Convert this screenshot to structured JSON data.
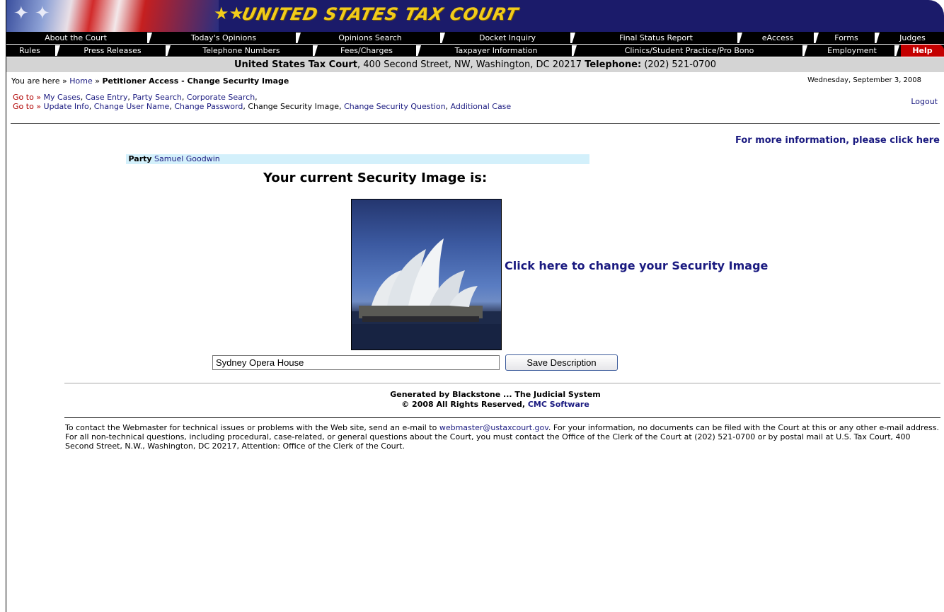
{
  "banner": {
    "title": "UNITED STATES TAX COURT",
    "stars": "★★",
    "flag_stars": [
      "✦",
      "✦"
    ]
  },
  "nav_row1": [
    {
      "label": "About the Court"
    },
    {
      "label": "Today's Opinions"
    },
    {
      "label": "Opinions Search"
    },
    {
      "label": "Docket Inquiry"
    },
    {
      "label": "Final Status Report"
    },
    {
      "label": "eAccess"
    },
    {
      "label": "Forms"
    },
    {
      "label": "Judges"
    }
  ],
  "nav_row2": [
    {
      "label": "Rules"
    },
    {
      "label": "Press Releases"
    },
    {
      "label": "Telephone Numbers"
    },
    {
      "label": "Fees/Charges"
    },
    {
      "label": "Taxpayer Information"
    },
    {
      "label": "Clinics/Student Practice/Pro Bono"
    },
    {
      "label": "Employment"
    },
    {
      "label": "Help"
    }
  ],
  "address": {
    "court": "United States Tax Court",
    "street": ", 400 Second Street, NW, Washington, DC 20217 ",
    "phone_label": "Telephone:",
    "phone": " (202) 521-0700"
  },
  "breadcrumb": {
    "prefix": "You are here »",
    "home": "Home",
    "sep": "»",
    "current": "Petitioner Access - Change Security Image"
  },
  "date": "Wednesday, September 3, 2008",
  "goto1": {
    "label": "Go to »",
    "links": [
      "My Cases",
      "Case Entry",
      "Party Search",
      "Corporate Search"
    ]
  },
  "goto2": {
    "label": "Go to »",
    "update_info": "Update Info",
    "change_user_name": "Change User Name",
    "change_password": "Change Password",
    "change_security_image": "Change Security Image",
    "change_security_question": "Change Security Question",
    "additional_case": "Additional Case"
  },
  "logout": "Logout",
  "more_info": "For more information, please click here",
  "party": {
    "label": "Party",
    "name": "Samuel Goodwin"
  },
  "security_title": "Your current Security Image is:",
  "change_image_link": "Click here to change your Security Image",
  "description_value": "Sydney Opera House",
  "save_button": "Save Description",
  "footer": {
    "generated": "Generated by Blackstone ... The Judicial System",
    "copyright": "© 2008 All Rights Reserved,",
    "cmc": "CMC Software"
  },
  "contact": {
    "p1": "To contact the Webmaster for technical issues or problems with the Web site, send an e-mail to ",
    "email": "webmaster@ustaxcourt.gov",
    "p2": ". For your information, no documents can be filed with the Court at this or any other e-mail address. For all non-technical questions, including procedural, case-related, or general questions about the Court, you must contact the Office of the Clerk of the Court at (202) 521-0700 or by postal mail at U.S. Tax Court, 400 Second Street, N.W., Washington, DC 20217, Attention: Office of the Clerk of the Court."
  },
  "colors": {
    "banner": "#1b1b6a",
    "title": "#f2cc1a",
    "link": "#1a1a80",
    "help": "#c40000",
    "party_bg": "#d3f0fb"
  }
}
